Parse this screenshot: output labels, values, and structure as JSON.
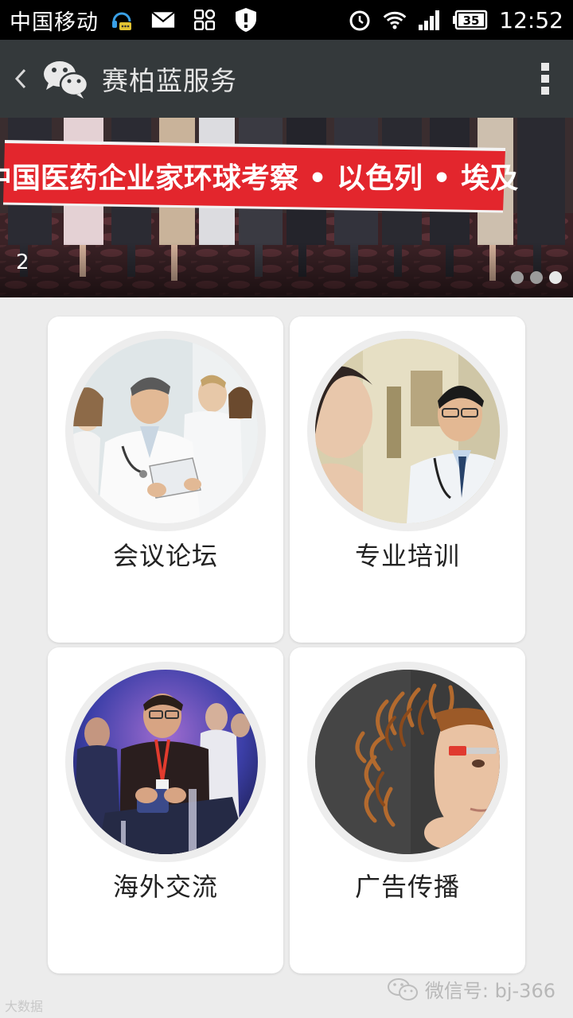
{
  "status_bar": {
    "carrier": "中国移动",
    "time": "12:52",
    "battery": "35",
    "icons_left": [
      "headset-chat-icon",
      "mail-icon",
      "apps-icon",
      "shield-icon"
    ],
    "icons_right": [
      "alarm-icon",
      "wifi-icon",
      "signal-icon",
      "battery-icon"
    ]
  },
  "nav": {
    "title": "赛柏蓝服务",
    "back_icon": "chevron-left-icon",
    "logo_icon": "wechat-logo-icon",
    "more_icon": "more-vertical-icon"
  },
  "banner": {
    "index": "2",
    "slogan": "中国医药企业家环球考察 • 以色列 • 埃及",
    "dots": 3,
    "active_dot": 2
  },
  "cards": [
    {
      "label": "会议论坛",
      "image": "doctors-meeting"
    },
    {
      "label": "专业培训",
      "image": "doctor-training"
    },
    {
      "label": "海外交流",
      "image": "overseas-exchange"
    },
    {
      "label": "广告传播",
      "image": "ad-media"
    }
  ],
  "footer": {
    "wechat_id": "微信号: bj-366",
    "left_mark": "大数据"
  },
  "colors": {
    "nav_bg": "#34393b",
    "page_bg": "#ececec",
    "banner_red": "#e3262d"
  }
}
